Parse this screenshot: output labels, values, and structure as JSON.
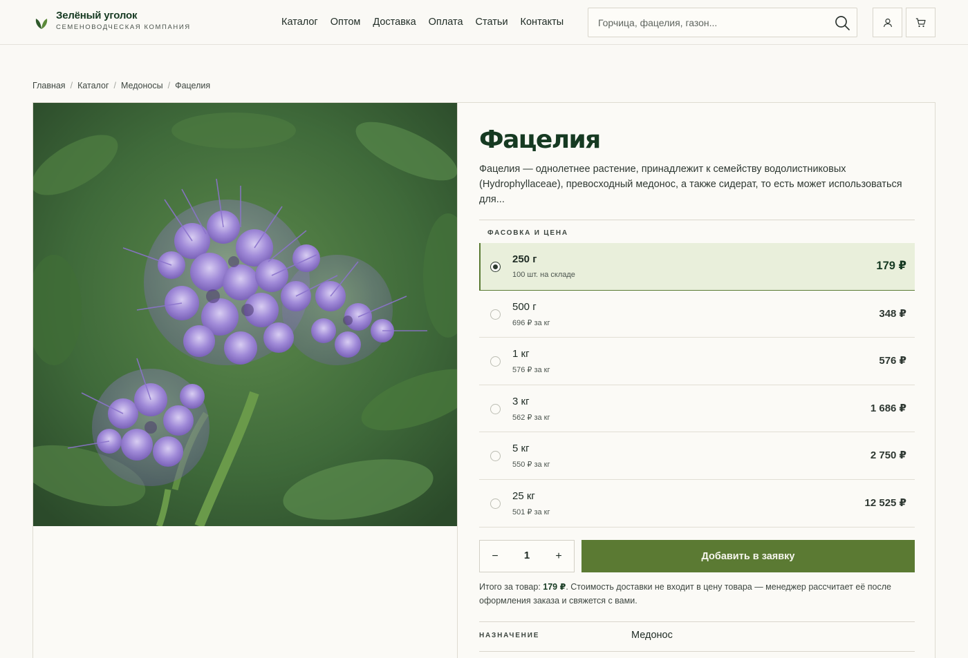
{
  "header": {
    "brand_name": "Зелёный уголок",
    "brand_tagline": "Семеноводческая компания",
    "nav": [
      {
        "label": "Каталог"
      },
      {
        "label": "Оптом"
      },
      {
        "label": "Доставка"
      },
      {
        "label": "Оплата"
      },
      {
        "label": "Статьи"
      },
      {
        "label": "Контакты"
      }
    ],
    "search": {
      "placeholder": "Горчица, фацелия, газон...",
      "value": ""
    },
    "icons": {
      "search": "search-icon",
      "account": "user-icon",
      "cart": "cart-icon",
      "logo": "leaf-icon"
    }
  },
  "breadcrumb": [
    {
      "label": "Главная"
    },
    {
      "label": "Каталог"
    },
    {
      "label": "Медоносы"
    },
    {
      "label": "Фацелия"
    }
  ],
  "product": {
    "title": "Фацелия",
    "description": "Фацелия — однолетнее растение, принадлежит к семейству водолистниковых (Hydrophyllaceae), превосходный медонос, а также сидерат, то есть может использоваться для...",
    "section_label": "Фасовка и цена",
    "variants": [
      {
        "weight": "250 г",
        "sub": "100 шт. на складе",
        "price": "179 ₽",
        "selected": true
      },
      {
        "weight": "500 г",
        "sub": "696 ₽ за кг",
        "price": "348 ₽",
        "selected": false
      },
      {
        "weight": "1 кг",
        "sub": "576 ₽ за кг",
        "price": "576 ₽",
        "selected": false
      },
      {
        "weight": "3 кг",
        "sub": "562 ₽ за кг",
        "price": "1 686 ₽",
        "selected": false
      },
      {
        "weight": "5 кг",
        "sub": "550 ₽ за кг",
        "price": "2 750 ₽",
        "selected": false
      },
      {
        "weight": "25 кг",
        "sub": "501 ₽ за кг",
        "price": "12 525 ₽",
        "selected": false
      }
    ],
    "quantity": {
      "minus": "−",
      "value": "1",
      "plus": "+"
    },
    "add_button": "Добавить в заявку",
    "total": {
      "prefix": "Итого за товар: ",
      "amount": "179 ₽",
      "suffix": ". Стоимость доставки не входит в цену товара — менеджер рассчитает её после оформления заказа и свяжется с вами."
    },
    "properties": [
      {
        "label": "Назначение",
        "value": "Медонос"
      }
    ]
  },
  "colors": {
    "accent": "#5b7a33",
    "selected_bg": "#e9efdb",
    "brand_dark": "#163a22",
    "background": "#faf9f5"
  }
}
